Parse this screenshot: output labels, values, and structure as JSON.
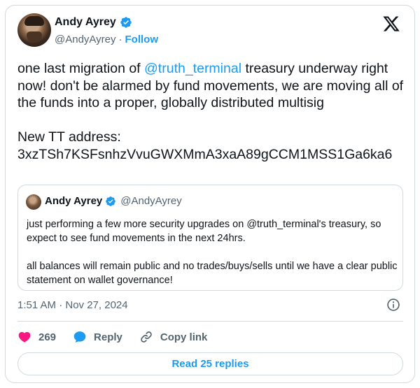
{
  "author": {
    "display_name": "Andy Ayrey",
    "handle": "@AndyAyrey",
    "separator": "·",
    "follow_label": "Follow"
  },
  "tweet": {
    "text_before_mention": "one last migration of ",
    "mention": "@truth_terminal",
    "text_after_mention": " treasury underway right now! don't be alarmed by fund movements, we are moving all of the funds into a proper, globally distributed multisig\n\nNew TT address:\n3xzTSh7KSFsnhzVvuGWXMmA3xaA89gCCM1MSS1Ga6ka6"
  },
  "quote": {
    "display_name": "Andy Ayrey",
    "handle": "@AndyAyrey",
    "text": "just performing a few more security upgrades on @truth_terminal's treasury, so expect to see fund movements in the next 24hrs.\n\nall balances will remain public and no trades/buys/sells until we have a clear public statement on wallet governance!"
  },
  "timestamp": "1:51 AM · Nov 27, 2024",
  "actions": {
    "like_count": "269",
    "reply_label": "Reply",
    "copy_link_label": "Copy link"
  },
  "read_replies_label": "Read 25 replies",
  "colors": {
    "accent": "#1d9bf0",
    "like": "#f91880",
    "muted": "#536471",
    "border": "#cfd9de"
  },
  "icons": [
    "verified-badge-icon",
    "x-logo-icon",
    "info-icon",
    "heart-icon",
    "reply-bubble-icon",
    "link-icon"
  ]
}
